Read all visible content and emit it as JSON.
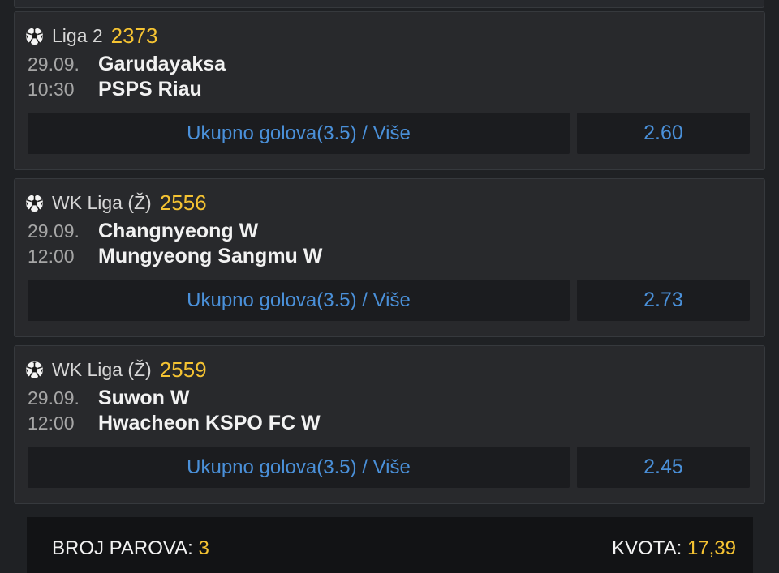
{
  "matches": [
    {
      "league": "Liga 2",
      "code": "2373",
      "date": "29.09.",
      "time": "10:30",
      "home": "Garudayaksa",
      "away": "PSPS Riau",
      "bet": "Ukupno golova(3.5) / Više",
      "odds": "2.60"
    },
    {
      "league": "WK Liga (Ž)",
      "code": "2556",
      "date": "29.09.",
      "time": "12:00",
      "home": "Changnyeong W",
      "away": "Mungyeong Sangmu W",
      "bet": "Ukupno golova(3.5) / Više",
      "odds": "2.73"
    },
    {
      "league": "WK Liga (Ž)",
      "code": "2559",
      "date": "29.09.",
      "time": "12:00",
      "home": "Suwon W",
      "away": "Hwacheon KSPO FC W",
      "bet": "Ukupno golova(3.5) / Više",
      "odds": "2.45"
    }
  ],
  "summary": {
    "pairs_label": "BROJ PAROVA:",
    "pairs_value": "3",
    "odds_label": "KVOTA:",
    "odds_value": "17,39"
  },
  "icons": {
    "sport": "soccer-ball-icon"
  },
  "colors": {
    "accent_yellow": "#f5c332",
    "link_blue": "#4a90d9",
    "card_bg": "#28292c",
    "page_bg": "#1f2124"
  }
}
